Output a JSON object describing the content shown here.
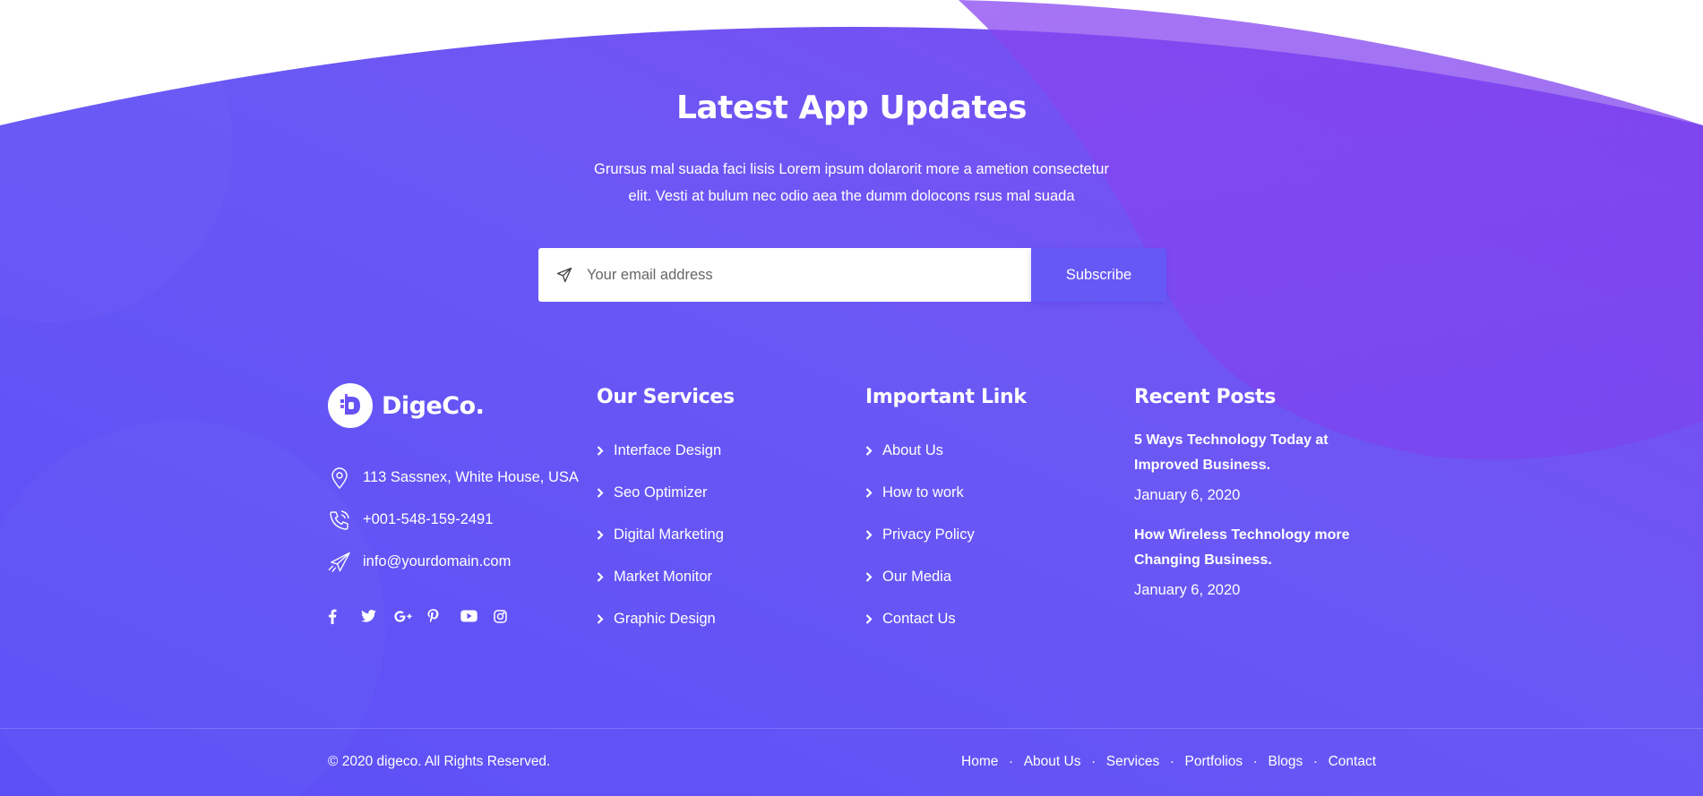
{
  "colors": {
    "gradient_start": "#5e4ff5",
    "gradient_end": "#8b43f0",
    "button": "#6658f5",
    "page_top": "#ffffff"
  },
  "newsletter": {
    "title": "Latest App Updates",
    "description": "Grursus mal suada faci lisis Lorem ipsum dolarorit more a ametion consectetur elit. Vesti at bulum nec odio aea the dumm dolocons rsus mal suada",
    "email_placeholder": "Your email address",
    "email_icon": "paper-plane-icon",
    "subscribe_label": "Subscribe"
  },
  "brand": {
    "name": "DigeCo.",
    "logo_icon": "digeco-logo-icon"
  },
  "contact": [
    {
      "icon": "map-pin-icon",
      "text": "113 Sassnex, White House, USA"
    },
    {
      "icon": "phone-icon",
      "text": "+001-548-159-2491"
    },
    {
      "icon": "paper-plane-icon",
      "text": "info@yourdomain.com"
    }
  ],
  "social": [
    "facebook-icon",
    "twitter-icon",
    "google-plus-icon",
    "pinterest-icon",
    "youtube-icon",
    "instagram-icon"
  ],
  "services": {
    "title": "Our Services",
    "items": [
      "Interface Design",
      "Seo Optimizer",
      "Digital Marketing",
      "Market Monitor",
      "Graphic Design"
    ]
  },
  "important_links": {
    "title": "Important Link",
    "items": [
      "About Us",
      "How to work",
      "Privacy Policy",
      "Our Media",
      "Contact Us"
    ]
  },
  "recent_posts": {
    "title": "Recent Posts",
    "items": [
      {
        "title": "5 Ways Technology Today at Improved Business.",
        "date": "January 6, 2020"
      },
      {
        "title": "How Wireless Technology more Changing Business.",
        "date": "January 6, 2020"
      }
    ]
  },
  "bottom": {
    "copyright": "© 2020 digeco. All Rights Reserved.",
    "separator": ".",
    "nav": [
      "Home",
      "About Us",
      "Services",
      "Portfolios",
      "Blogs",
      "Contact"
    ]
  }
}
